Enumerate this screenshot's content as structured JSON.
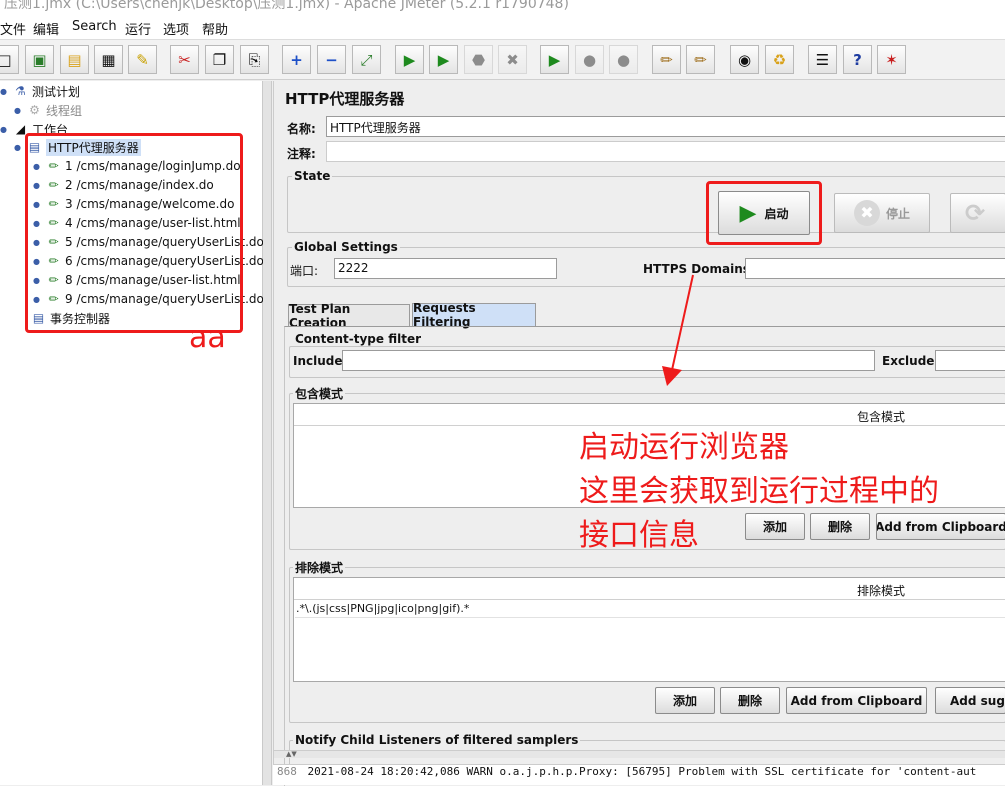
{
  "window": {
    "title": "压测1.jmx (C:\\Users\\chenjk\\Desktop\\压测1.jmx) - Apache JMeter (5.2.1 r1790748)"
  },
  "menu": [
    "文件",
    "编辑",
    "Search",
    "运行",
    "选项",
    "帮助"
  ],
  "tree": {
    "test_plan": "测试计划",
    "thread_group": "线程组",
    "workbench": "工作台",
    "proxy": "HTTP代理服务器",
    "samplers": [
      "1 /cms/manage/loginJump.do",
      "2 /cms/manage/index.do",
      "3 /cms/manage/welcome.do",
      "4 /cms/manage/user-list.html",
      "5 /cms/manage/queryUserList.do",
      "6 /cms/manage/queryUserList.do",
      "8 /cms/manage/user-list.html",
      "9 /cms/manage/queryUserList.do"
    ],
    "transaction": "事务控制器",
    "annotation": "aa"
  },
  "panel": {
    "title": "HTTP代理服务器",
    "name_label": "名称:",
    "name_value": "HTTP代理服务器",
    "comment_label": "注释:",
    "state_title": "State",
    "start_label": "启动",
    "stop_label": "停止",
    "global_title": "Global Settings",
    "port_label": "端口:",
    "port_value": "2222",
    "https_label": "HTTPS Domains :",
    "tab_creation": "Test Plan Creation",
    "tab_filtering": "Requests Filtering",
    "content_type_title": "Content-type filter",
    "include_label": "Include:",
    "exclude_label": "Exclude:",
    "include_pattern_title": "包含模式",
    "include_col": "包含模式",
    "exclude_pattern_title": "排除模式",
    "exclude_col": "排除模式",
    "exclude_rows": [
      ".*\\.(js|css|PNG|jpg|ico|png|gif).*"
    ],
    "add_label": "添加",
    "delete_label": "删除",
    "clipboard_label": "Add from Clipboard",
    "suggested_label": "Add sugge",
    "notify_title": "Notify Child Listeners of filtered samplers"
  },
  "annotation_text": [
    "启动运行浏览器",
    "这里会获取到运行过程中的",
    "接口信息"
  ],
  "log": {
    "line_no": "868",
    "text": "2021-08-24 18:20:42,086 WARN o.a.j.p.h.p.Proxy: [56795] Problem with SSL certificate for 'content-aut"
  },
  "colors": {
    "annotation_red": "#ee1b1b",
    "selected": "#cfe0f7",
    "start_green": "#1e8a1e"
  }
}
